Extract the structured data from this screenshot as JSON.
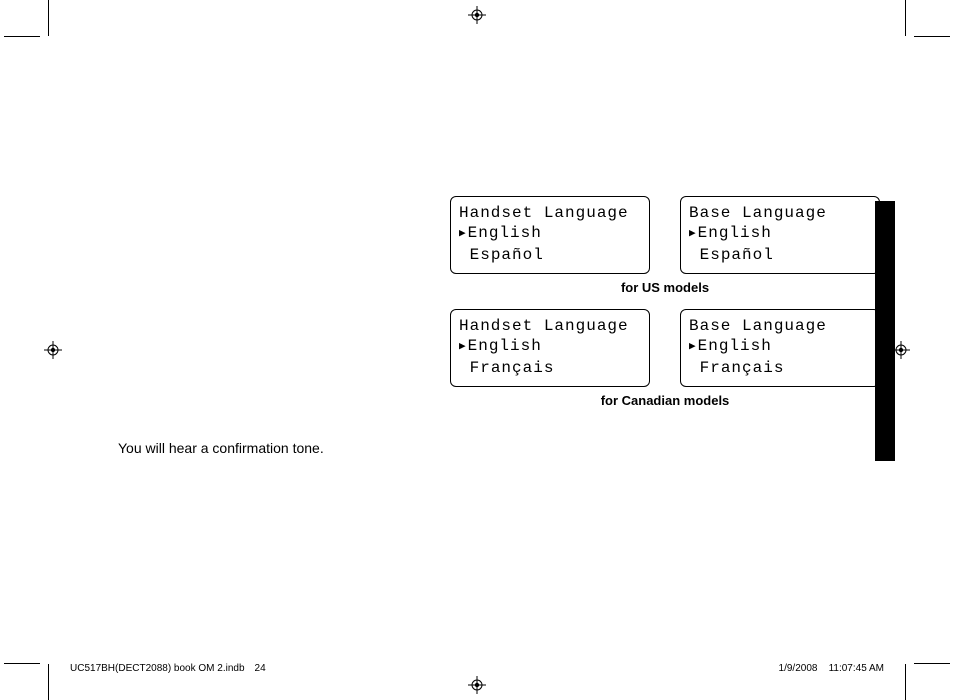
{
  "body_text": "You will hear a confirmation tone.",
  "screens": {
    "us": {
      "caption": "for US models",
      "handset": {
        "title": "Handset Language",
        "selected": "English",
        "other": "Español"
      },
      "base": {
        "title": "Base Language",
        "selected": "English",
        "other": "Español"
      }
    },
    "ca": {
      "caption": "for Canadian models",
      "handset": {
        "title": "Handset Language",
        "selected": "English",
        "other": "Français"
      },
      "base": {
        "title": "Base Language",
        "selected": "English",
        "other": "Français"
      }
    }
  },
  "footer": {
    "doc": "UC517BH(DECT2088) book OM 2.indb",
    "page": "24",
    "date": "1/9/2008",
    "time": "11:07:45 AM"
  }
}
